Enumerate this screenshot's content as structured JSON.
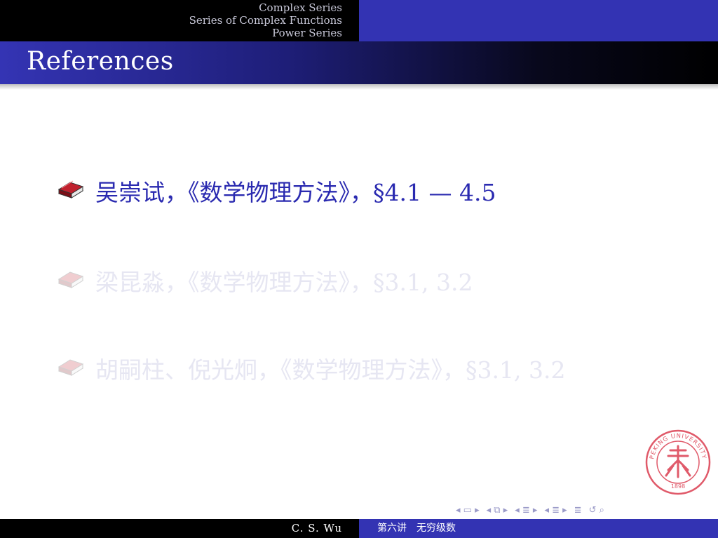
{
  "header": {
    "sections": [
      "Complex Series",
      "Series of Complex Functions",
      "Power Series"
    ]
  },
  "frame": {
    "title": "References"
  },
  "references": [
    {
      "text": "吴崇试，《数学物理方法》，§4.1 — 4.5",
      "state": "active",
      "icon": "book-icon"
    },
    {
      "text": "梁昆淼，《数学物理方法》，§3.1, 3.2",
      "state": "dimmed",
      "icon": "book-icon"
    },
    {
      "text": "胡嗣柱、倪光炯，《数学物理方法》，§3.1, 3.2",
      "state": "dimmed",
      "icon": "book-icon"
    }
  ],
  "seal": {
    "text": "PEKING UNIVERSITY",
    "year": "1898",
    "color": "#e05a6a"
  },
  "footer": {
    "author": "C. S. Wu",
    "lecture": "第六讲　无穷级数"
  },
  "colors": {
    "header_blue": "#3333b3",
    "active_text": "#2a2ab0",
    "dimmed_text": "#e6e6f2",
    "book_red": "#b01e2a"
  },
  "nav": {
    "icons": [
      "frame-nav-icon",
      "subsection-nav-icon",
      "section-nav-icon",
      "presentation-nav-icon",
      "appendix-nav-icon",
      "search-nav-icon"
    ]
  }
}
